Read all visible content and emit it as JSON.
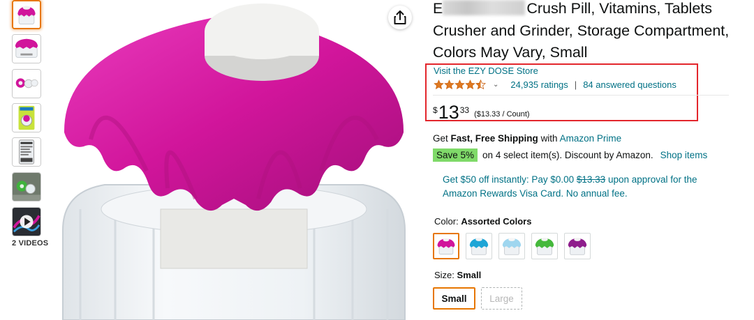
{
  "product": {
    "title_after_blur": "Crush Pill, Vitamins, Tablets Crusher and Grinder, Storage Compartment, Colors May Vary, Small",
    "title_before_blur": "E"
  },
  "store": {
    "link_text": "Visit the EZY DOSE Store"
  },
  "rating": {
    "stars": 4.5,
    "ratings_text": "24,935 ratings",
    "separator": "|",
    "questions_text": "84 answered questions"
  },
  "price": {
    "currency": "$",
    "whole": "13",
    "fraction": "33",
    "per_unit": "($13.33 / Count)"
  },
  "shipping": {
    "prefix": "Get",
    "bold": "Fast, Free Shipping",
    "middle": "with",
    "prime_link": "Amazon Prime"
  },
  "coupon": {
    "badge": "Save 5%",
    "text": "on 4 select item(s). Discount by Amazon.",
    "link": "Shop items"
  },
  "promo": {
    "part1": "Get $50 off instantly: Pay $0.00",
    "strike": "$13.33",
    "part2": "upon approval for the Amazon Rewards Visa Card. No annual fee."
  },
  "color": {
    "label": "Color:",
    "selected": "Assorted Colors",
    "options": [
      "magenta",
      "teal",
      "light-blue",
      "green",
      "purple"
    ]
  },
  "size": {
    "label": "Size:",
    "selected": "Small",
    "options": [
      "Small",
      "Large"
    ]
  },
  "gallery": {
    "videos_label": "2 VIDEOS",
    "thumbnail_count": 7
  },
  "colors": {
    "link": "#007185",
    "accent_orange": "#e77600",
    "highlight_red": "#e3262c",
    "save_badge": "#7fda69",
    "cap_magenta": "#d1159b"
  }
}
